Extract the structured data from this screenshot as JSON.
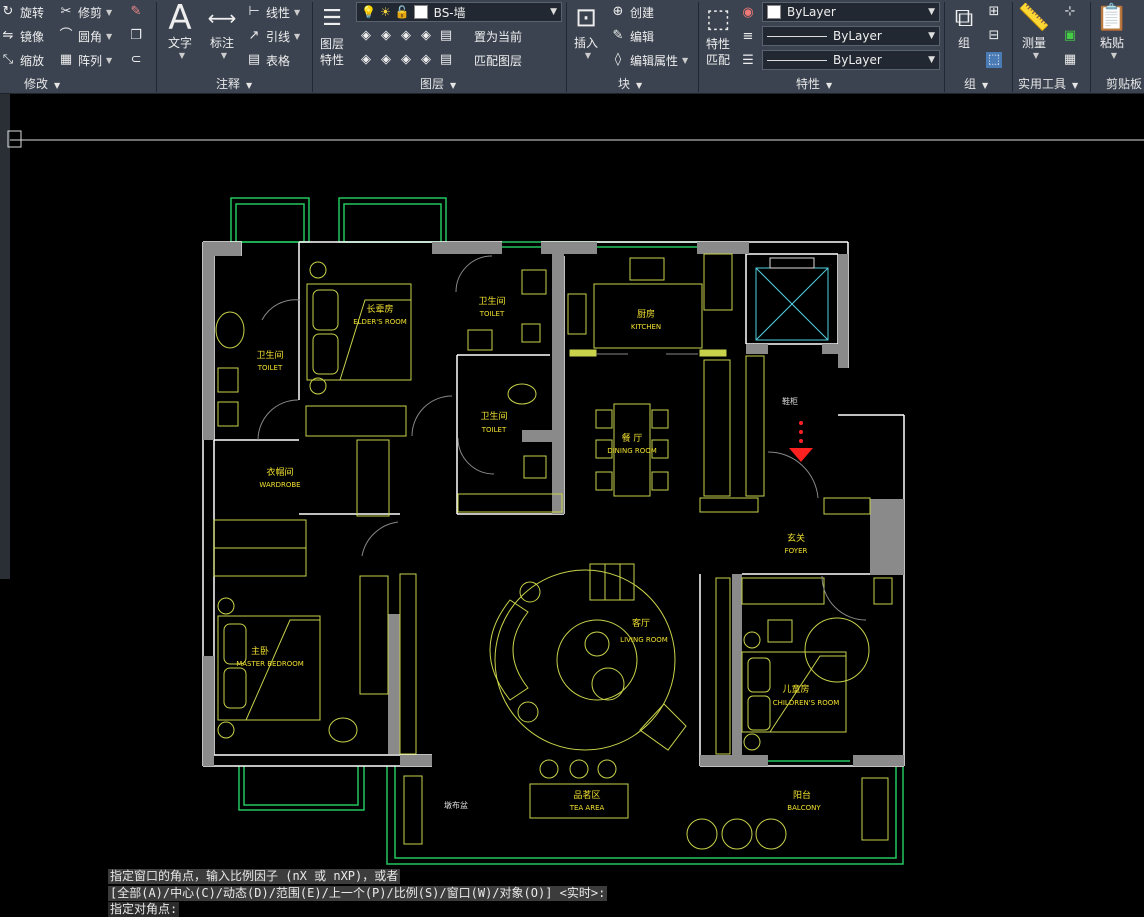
{
  "modify": {
    "rotate": "旋转",
    "trim": "修剪",
    "mirror": "镜像",
    "fillet": "圆角",
    "scale": "缩放",
    "array": "阵列",
    "title": "修改"
  },
  "annotation": {
    "text": "文字",
    "dimension": "标注",
    "linear": "线性",
    "leader": "引线",
    "table": "表格",
    "title": "注释"
  },
  "layers": {
    "props": "图层\n特性",
    "current_layer": "BS-墙",
    "set_current": "置为当前",
    "match_layer": "匹配图层",
    "title": "图层"
  },
  "block": {
    "insert": "插入",
    "create": "创建",
    "edit": "编辑",
    "edit_attr": "编辑属性",
    "title": "块"
  },
  "properties": {
    "match": "特性\n匹配",
    "color": "ByLayer",
    "linetype": "ByLayer",
    "lineweight": "ByLayer",
    "title": "特性"
  },
  "group": {
    "label": "组",
    "title": "组"
  },
  "utilities": {
    "measure": "测量",
    "title": "实用工具"
  },
  "clipboard": {
    "paste": "粘贴",
    "title": "剪贴板"
  },
  "plan": {
    "rooms": [
      {
        "cn": "长辈房",
        "en": "ELDER'S ROOM"
      },
      {
        "cn": "卫生间",
        "en": "TOILET"
      },
      {
        "cn": "厨房",
        "en": "KITCHEN"
      },
      {
        "cn": "卫生间",
        "en": "TOILET"
      },
      {
        "cn": "卫生间",
        "en": "TOILET"
      },
      {
        "cn": "餐 厅",
        "en": "DINING ROOM"
      },
      {
        "cn": "衣帽间",
        "en": "WARDROBE"
      },
      {
        "cn": "玄关",
        "en": "FOYER"
      },
      {
        "cn": "客厅",
        "en": "LIVING ROOM"
      },
      {
        "cn": "主卧",
        "en": "MASTER BEDROOM"
      },
      {
        "cn": "儿童房",
        "en": "CHILDREN'S ROOM"
      },
      {
        "cn": "品茗区",
        "en": "TEA AREA"
      },
      {
        "cn": "阳台",
        "en": "BALCONY"
      }
    ],
    "shoe_cabinet": "鞋柜",
    "laundry": "墩布盆"
  },
  "command": {
    "line1": "指定窗口的角点，输入比例因子 (nX 或 nXP)，或者",
    "line2": "[全部(A)/中心(C)/动态(D)/范围(E)/上一个(P)/比例(S)/窗口(W)/对象(O)] <实时>:",
    "line3": "指定对角点:"
  },
  "colors": {
    "wall": "#ffffff",
    "furniture": "#c8d24a",
    "window": "#22c55e",
    "label": "#f0e030",
    "accent": "#ff2020"
  }
}
